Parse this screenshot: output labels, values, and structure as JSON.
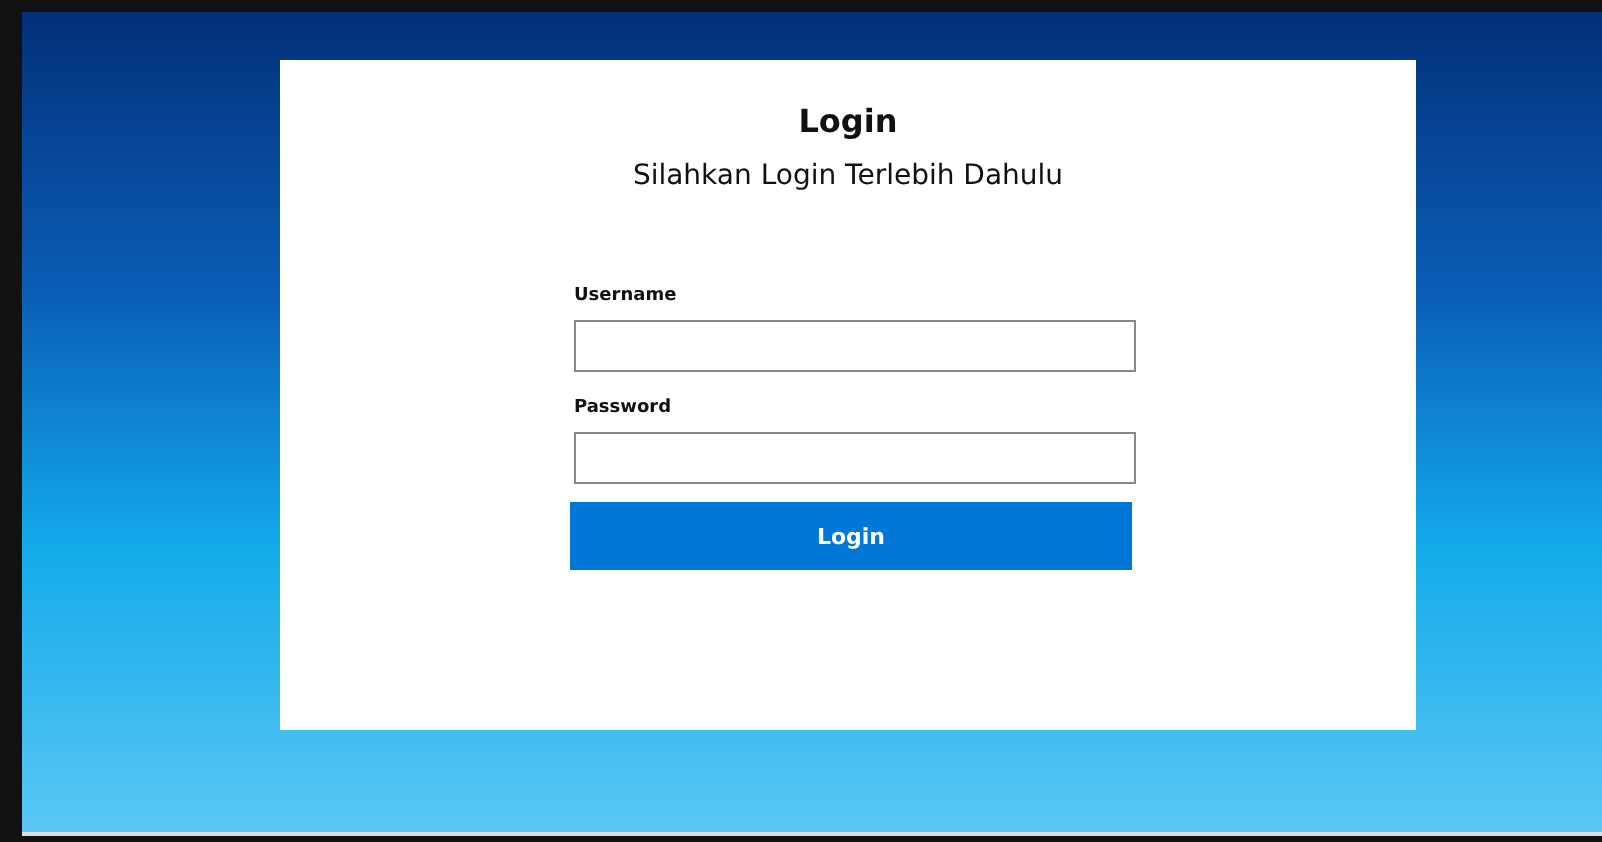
{
  "card": {
    "title": "Login",
    "subtitle": "Silahkan Login Terlebih Dahulu"
  },
  "fields": [
    {
      "label": "Username"
    },
    {
      "label": "Password"
    }
  ],
  "button": {
    "label": "Login"
  }
}
